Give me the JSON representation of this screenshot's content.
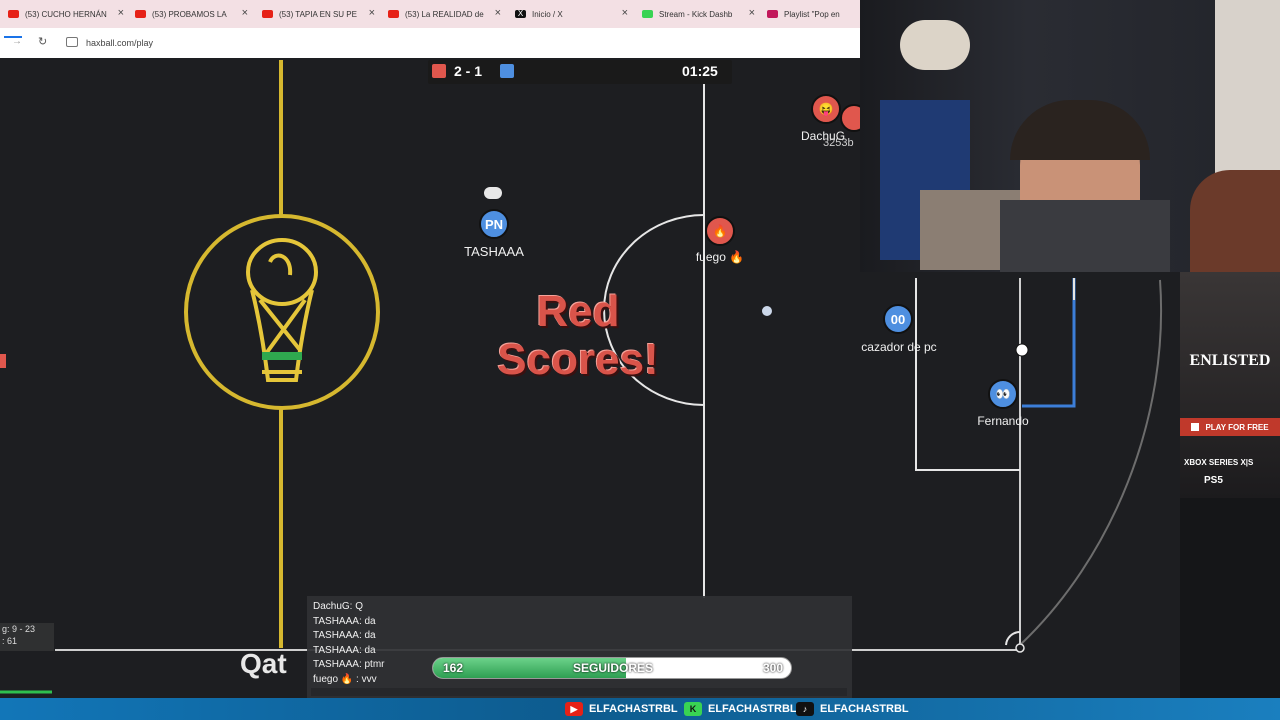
{
  "browser": {
    "tabs": [
      {
        "label": "(53) CUCHO HERNÁN",
        "icon": "youtube-icon",
        "color": "#e62117"
      },
      {
        "label": "(53) PROBAMOS LA",
        "icon": "youtube-icon",
        "color": "#e62117"
      },
      {
        "label": "(53) TAPIA EN SU PE",
        "icon": "youtube-icon",
        "color": "#e62117"
      },
      {
        "label": "(53) La REALIDAD de",
        "icon": "youtube-icon",
        "color": "#e62117"
      },
      {
        "label": "Inicio / X",
        "icon": "x-icon",
        "color": "#111111"
      },
      {
        "label": "Stream - Kick Dashb",
        "icon": "kick-icon",
        "color": "#39d353"
      },
      {
        "label": "Playlist \"Pop en",
        "icon": "playlist-icon",
        "color": "#c2185b"
      }
    ],
    "url": "haxball.com/play"
  },
  "game": {
    "score": "2 - 1",
    "red_color": "#e0574d",
    "blue_color": "#4e8fe0",
    "timer": "01:25",
    "announcement": [
      "Red",
      "Scores!"
    ],
    "stadium_logo_text": "Qat",
    "players": [
      {
        "avatar": "PN",
        "name": "TASHAAA",
        "team": "blue"
      },
      {
        "avatar": "🔥",
        "name": "fuego 🔥",
        "team": "red"
      },
      {
        "avatar": "00",
        "name": "cazador de pc",
        "team": "blue"
      },
      {
        "avatar": "👀",
        "name": "Fernando",
        "team": "blue"
      },
      {
        "avatar": "😝",
        "name": "DachuG",
        "team": "red"
      }
    ],
    "offscreen_fragment": "3253b",
    "left_stats": [
      "g: 9 - 23",
      ": 61"
    ]
  },
  "chat": {
    "lines": [
      "DachuG: Q",
      "TASHAAA: da",
      "TASHAAA: da",
      "TASHAAA: da",
      "TASHAAA: ptmr",
      "fuego 🔥 : vvv"
    ]
  },
  "followers": {
    "current": "162",
    "label": "SEGUIDORES",
    "goal": "300",
    "progress": 0.54
  },
  "ad": {
    "title": "ENLISTED",
    "cta": "PLAY FOR FREE",
    "platform1": "XBOX SERIES X|S",
    "platform2": "PS5"
  },
  "socials": [
    {
      "icon": "youtube-icon",
      "handle": "ELFACHASTRBL",
      "color": "#e62117"
    },
    {
      "icon": "kick-icon",
      "handle": "ELFACHASTRBL",
      "color": "#39d353"
    },
    {
      "icon": "tiktok-icon",
      "handle": "ELFACHASTRBL",
      "color": "#111111"
    }
  ]
}
